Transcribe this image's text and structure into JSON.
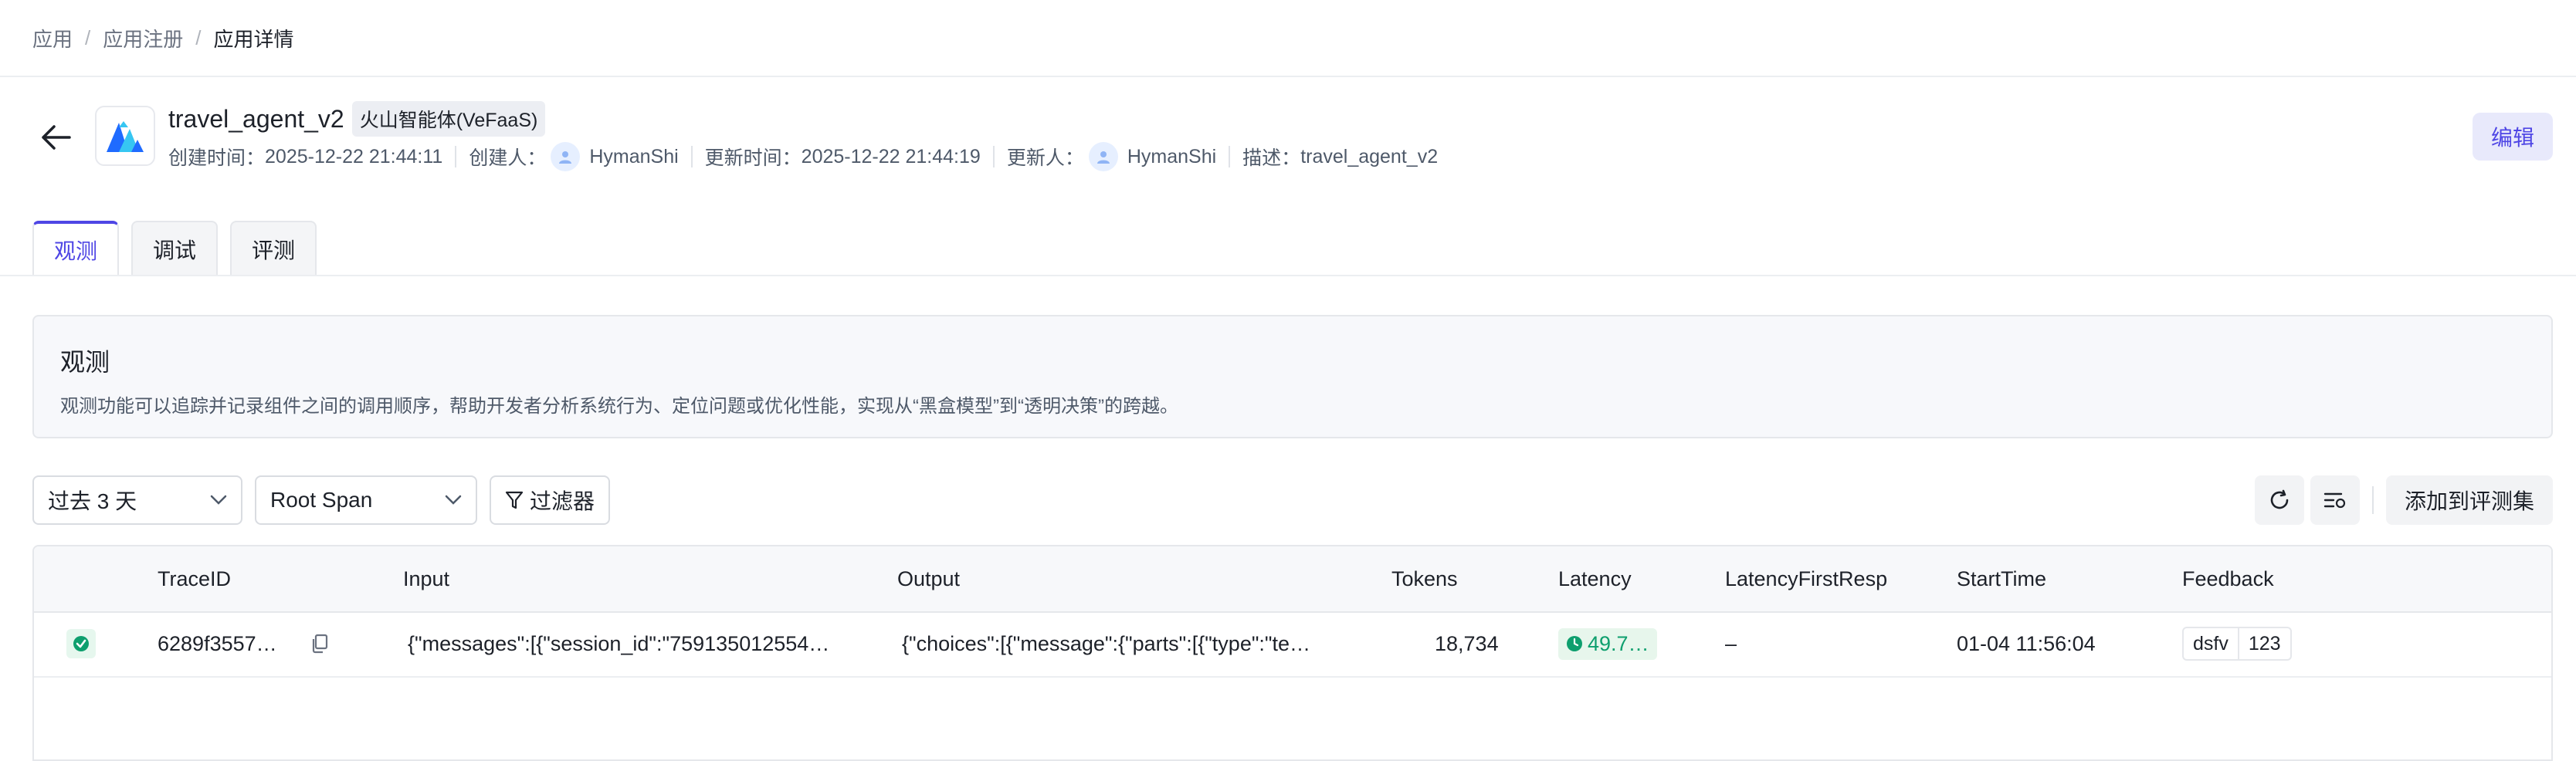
{
  "breadcrumb": {
    "items": [
      "应用",
      "应用注册",
      "应用详情"
    ],
    "separator": "/"
  },
  "header": {
    "app_name": "travel_agent_v2",
    "tag": "火山智能体(VeFaaS)",
    "created_time_label": "创建时间：",
    "created_time": "2025-12-22 21:44:11",
    "creator_label": "创建人：",
    "creator": "HymanShi",
    "updated_time_label": "更新时间：",
    "updated_time": "2025-12-22 21:44:19",
    "updater_label": "更新人：",
    "updater": "HymanShi",
    "desc_label": "描述：",
    "desc": "travel_agent_v2",
    "edit_label": "编辑"
  },
  "tabs": [
    {
      "label": "观测",
      "active": true
    },
    {
      "label": "调试",
      "active": false
    },
    {
      "label": "评测",
      "active": false
    }
  ],
  "info": {
    "title": "观测",
    "description": "观测功能可以追踪并记录组件之间的调用顺序，帮助开发者分析系统行为、定位问题或优化性能，实现从“黑盒模型”到“透明决策”的跨越。"
  },
  "filters": {
    "time_range": "过去 3 天",
    "span_type": "Root Span",
    "filter_label": "过滤器",
    "add_to_eval_label": "添加到评测集"
  },
  "table": {
    "columns": [
      "TraceID",
      "Input",
      "Output",
      "Tokens",
      "Latency",
      "LatencyFirstResp",
      "StartTime",
      "Feedback"
    ],
    "rows": [
      {
        "trace_id": "6289f3557…",
        "input": "{\"messages\":[{\"session_id\":\"759135012554…",
        "output": "{\"choices\":[{\"message\":{\"parts\":[{\"type\":\"te…",
        "tokens": "18,734",
        "latency": "49.7…",
        "latency_first_resp": "–",
        "start_time": "01-04 11:56:04",
        "feedback_key": "dsfv",
        "feedback_value": "123"
      }
    ]
  },
  "colors": {
    "accent": "#4f46e5",
    "success": "#0e9f6e",
    "logo_blue": "#1f6bff",
    "logo_cyan": "#36c6f2"
  }
}
